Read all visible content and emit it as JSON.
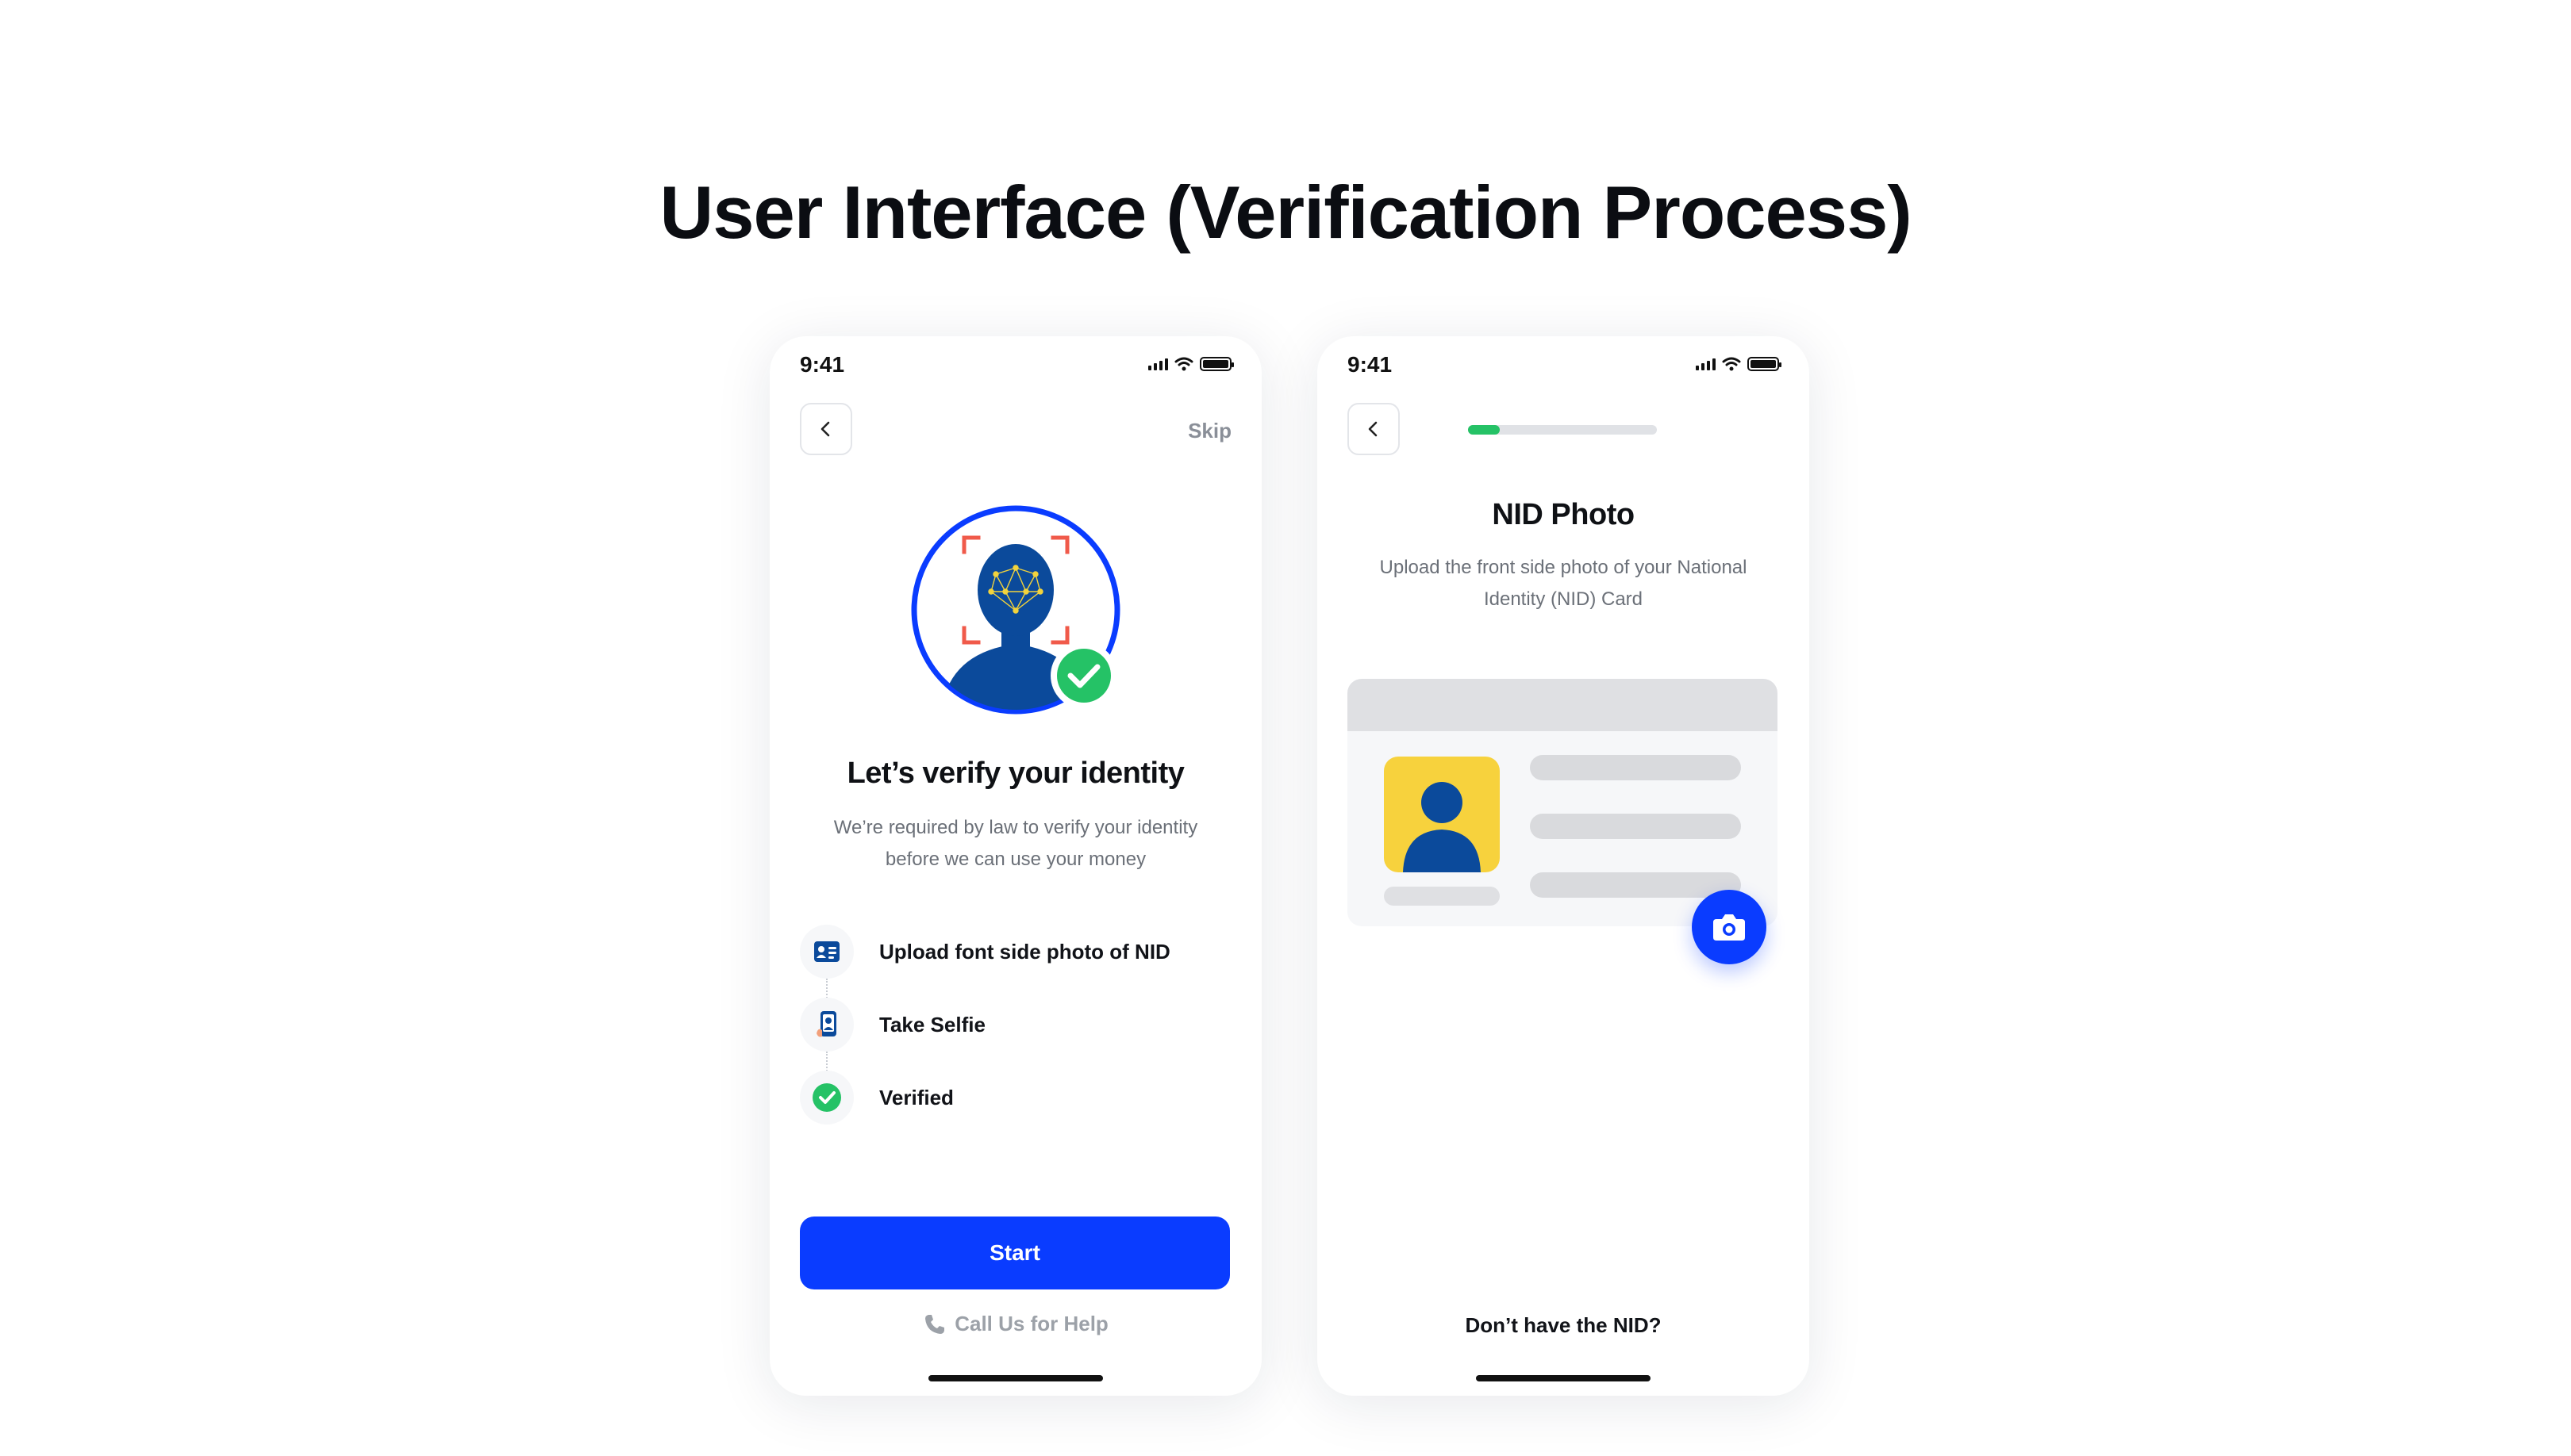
{
  "page": {
    "title": "User Interface (Verification Process)"
  },
  "status_bar": {
    "time": "9:41"
  },
  "screen_intro": {
    "skip_label": "Skip",
    "title": "Let’s verify your identity",
    "subtitle": "We’re required by law to verify your identity before we can use your money",
    "steps": [
      {
        "label": "Upload font side photo of NID",
        "icon": "id-card-icon"
      },
      {
        "label": "Take Selfie",
        "icon": "selfie-phone-icon"
      },
      {
        "label": "Verified",
        "icon": "check-circle-icon"
      }
    ],
    "start_label": "Start",
    "help_label": "Call Us for Help"
  },
  "screen_nid": {
    "progress": 0.17,
    "title": "NID Photo",
    "subtitle": "Upload the front side photo of your National Identity (NID) Card",
    "no_nid_label": "Don’t have the NID?"
  },
  "colors": {
    "primary": "#0A3CFF",
    "success": "#25C266",
    "id_photo_bg": "#F7D23D",
    "avatar": "#0B4A9B",
    "face_frame": "#F05A4A"
  }
}
